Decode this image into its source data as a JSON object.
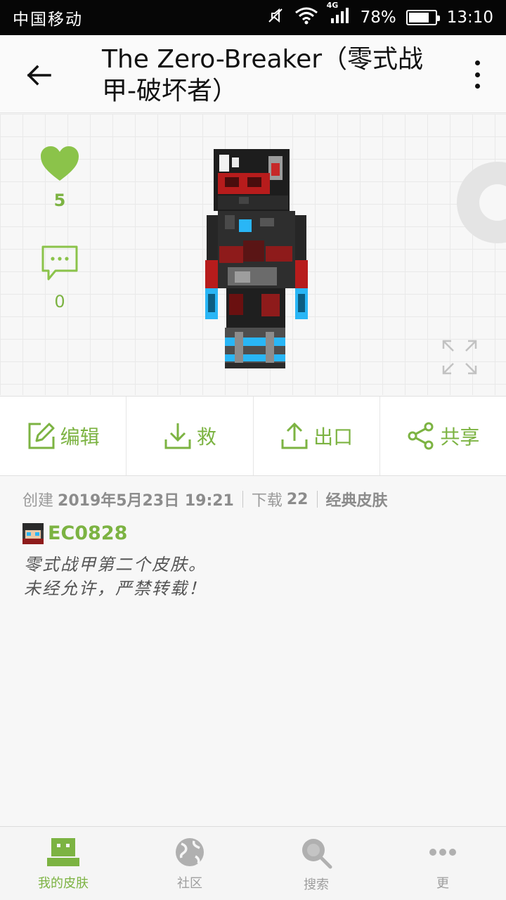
{
  "status_bar": {
    "carrier": "中国移动",
    "network": "4G",
    "battery_percent": "78%",
    "battery_level": 0.78,
    "time": "13:10"
  },
  "app_bar": {
    "title": "The Zero-Breaker（零式战甲-破坏者）"
  },
  "preview": {
    "likes": "5",
    "comments": "0"
  },
  "actions": [
    {
      "label": "编辑",
      "icon": "edit-icon"
    },
    {
      "label": "救",
      "icon": "download-icon"
    },
    {
      "label": "出口",
      "icon": "upload-icon"
    },
    {
      "label": "共享",
      "icon": "share-icon"
    }
  ],
  "meta": {
    "created_label": "创建",
    "created_value": "2019年5月23日 19:21",
    "downloads_label": "下载",
    "downloads_value": "22",
    "category": "经典皮肤"
  },
  "author": {
    "name": "EC0828"
  },
  "description": [
    "零式战甲第二个皮肤。",
    "未经允许，严禁转载！"
  ],
  "bottom_nav": [
    {
      "label": "我的皮肤",
      "icon": "my-skins-icon",
      "active": true
    },
    {
      "label": "社区",
      "icon": "globe-icon",
      "active": false
    },
    {
      "label": "搜索",
      "icon": "search-icon",
      "active": false
    },
    {
      "label": "更",
      "icon": "more-dots-icon",
      "active": false
    }
  ],
  "colors": {
    "accent": "#7cb342",
    "heart": "#8bc34a"
  }
}
